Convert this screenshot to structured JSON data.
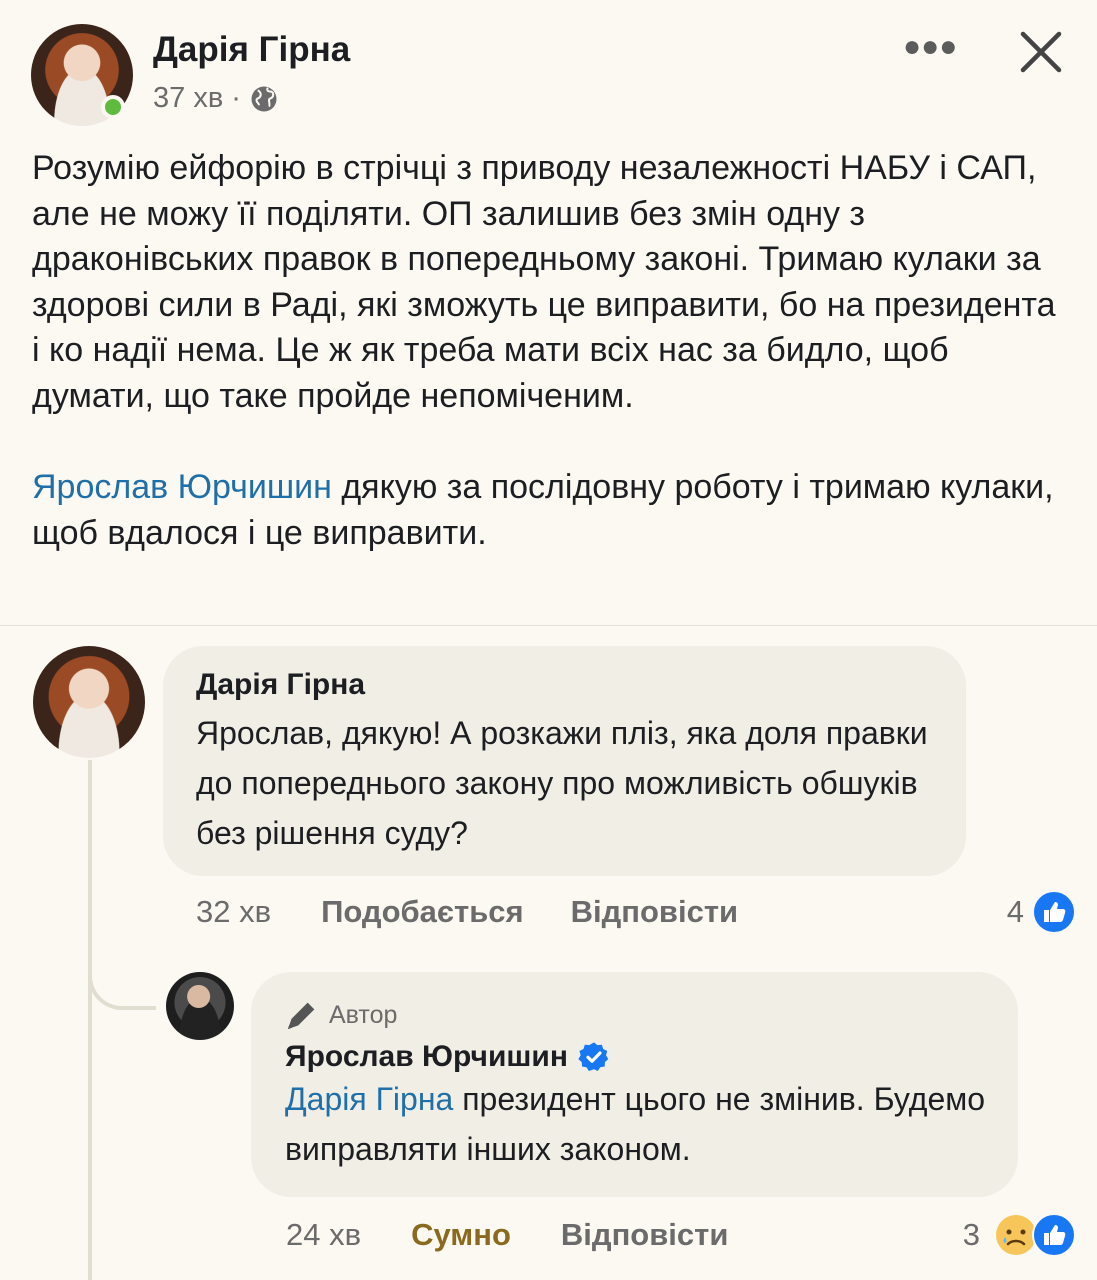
{
  "post": {
    "author": "Дарія Гірна",
    "time": "37 хв",
    "separator": "·",
    "paragraph1": "Розумію ейфорію в стрічці з приводу незалежності НАБУ і САП, але не можу її поділяти. ОП залишив без змін одну з драконівських правок в попередньому законі. Тримаю кулаки за здорові сили в Раді, які зможуть це виправити, бо на президента і ко надії нема. Це ж як треба мати всіх нас за бидло, щоб думати, що таке пройде непоміченим.",
    "mention": "Ярослав Юрчишин",
    "paragraph2_rest": " дякую за послідовну роботу і тримаю кулаки, щоб вдалося і це виправити."
  },
  "comment1": {
    "author": "Дарія Гірна",
    "text": "Ярослав, дякую! А розкажи пліз, яка доля правки до попереднього закону про можливість обшуків без рішення суду?",
    "time": "32 хв",
    "like_label": "Подобається",
    "reply_label": "Відповісти",
    "reaction_count": "4"
  },
  "comment2": {
    "badge": "Автор",
    "author": "Ярослав Юрчишин",
    "mention": "Дарія Гірна",
    "text_rest": " президент цього не змінив. Будемо виправляти інших законом.",
    "time": "24 хв",
    "reaction_label": "Сумно",
    "reply_label": "Відповісти",
    "reaction_count": "3"
  },
  "colors": {
    "background": "#fbf9f2",
    "mention": "#1f6fa8",
    "bubble": "#f1eee6",
    "online": "#5fbb3d",
    "sad_reaction": "#8a6a1e",
    "like_blue": "#1877f2"
  },
  "icons": [
    "globe-icon",
    "more-icon",
    "close-icon",
    "like-icon",
    "sad-icon",
    "verified-icon",
    "pen-icon"
  ]
}
